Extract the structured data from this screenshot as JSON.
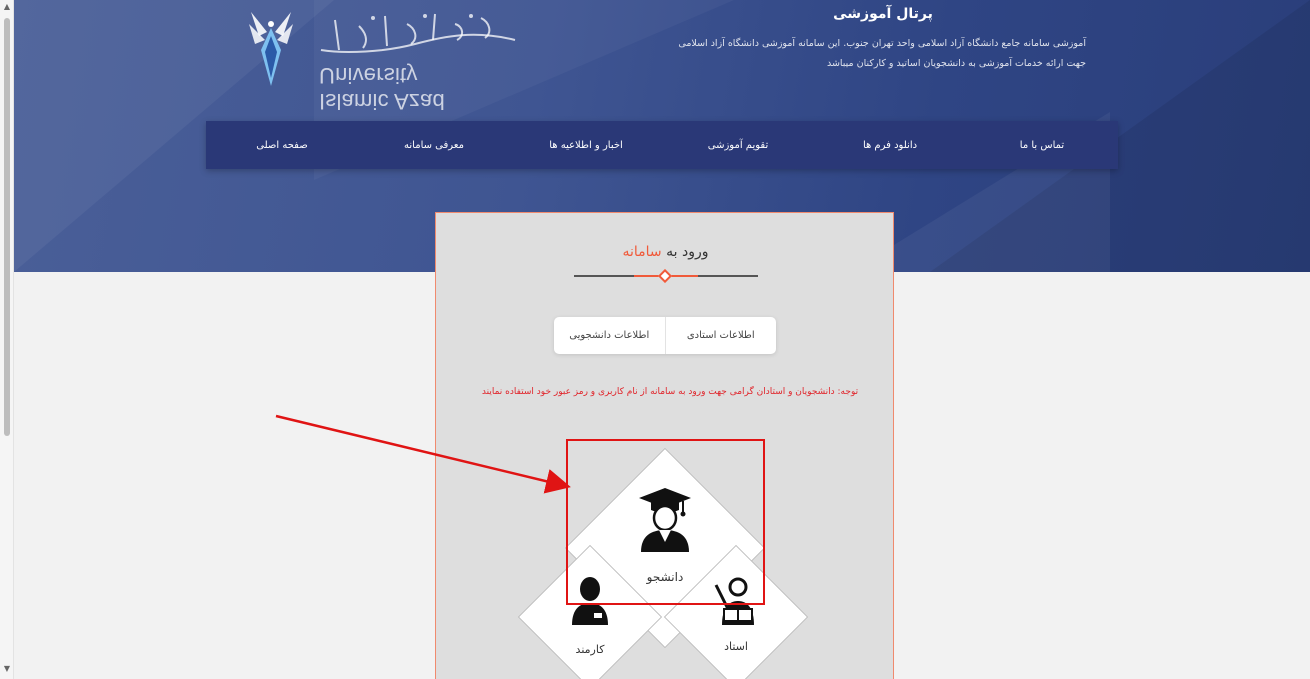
{
  "header": {
    "logo_text": "Islamic Azad University",
    "site_title": "پرتال آموزشی",
    "site_description": "آموزشی سامانه جامع دانشگاه آزاد اسلامی واحد تهران جنوب. این سامانه آموزشی دانشگاه آزاد اسلامی جهت ارائه خدمات آموزشی به دانشجویان اساتید و کارکنان میباشد"
  },
  "nav": {
    "items": [
      {
        "label": "صفحه اصلی"
      },
      {
        "label": "معرفی سامانه"
      },
      {
        "label": "اخبار و اطلاعیه ها"
      },
      {
        "label": "تقویم آموزشی"
      },
      {
        "label": "دانلود فرم ها"
      },
      {
        "label": "تماس با ما"
      }
    ]
  },
  "login": {
    "title_main": "ورود به",
    "title_accent": "سامانه",
    "tabs": [
      {
        "label": "اطلاعات استادی"
      },
      {
        "label": "اطلاعات دانشجویی"
      }
    ],
    "notice": "توجه: دانشجویان و استادان گرامی جهت ورود به سامانه از نام کاربری و رمز عبور خود استفاده نمایند",
    "roles": {
      "student": "دانشجو",
      "staff": "کارمند",
      "teacher": "استاد"
    }
  },
  "colors": {
    "accent": "#f05a3a",
    "notice": "#e0242a",
    "nav_bg": "#2a3877",
    "annotation": "#e01414"
  }
}
